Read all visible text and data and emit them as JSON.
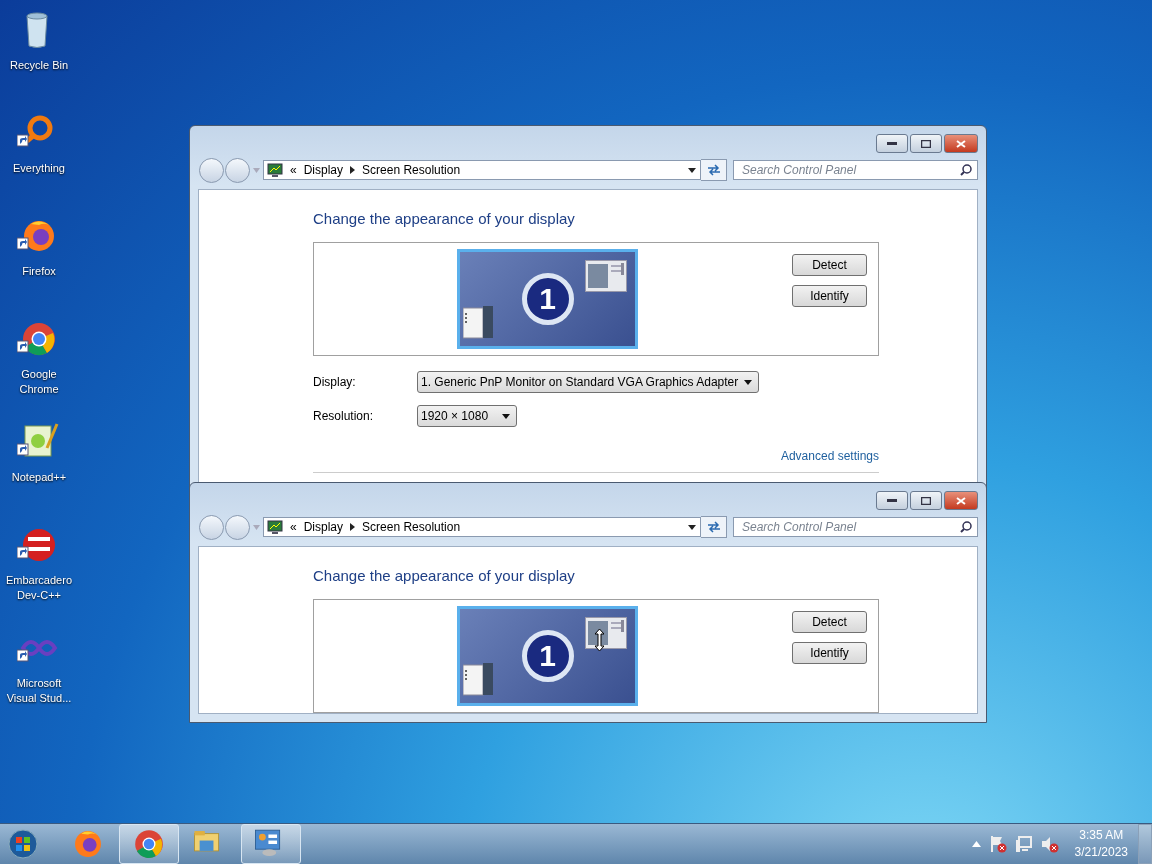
{
  "desktop_icons": [
    {
      "kind": "recycle",
      "label": "Recycle Bin",
      "shortcut": false
    },
    {
      "kind": "everything",
      "label": "Everything",
      "shortcut": true
    },
    {
      "kind": "firefox",
      "label": "Firefox",
      "shortcut": true
    },
    {
      "kind": "chrome",
      "label": "Google Chrome",
      "shortcut": true
    },
    {
      "kind": "notepad",
      "label": "Notepad++",
      "shortcut": true
    },
    {
      "kind": "devcpp",
      "label": "Embarcadero Dev-C++",
      "shortcut": true
    },
    {
      "kind": "vs",
      "label": "Microsoft Visual Stud...",
      "shortcut": true
    }
  ],
  "windows": [
    {
      "overflow": "«",
      "breadcrumb": [
        "Display",
        "Screen Resolution"
      ],
      "search": {
        "placeholder": "Search Control Panel"
      },
      "heading": "Change the appearance of your display",
      "monitor_number": "1",
      "resize_cursor": false,
      "buttons": [
        "Detect",
        "Identify"
      ],
      "settings": [
        {
          "label": "Display:",
          "value": "1. Generic PnP Monitor on Standard VGA Graphics Adapter",
          "kind": "wide"
        },
        {
          "label": "Resolution:",
          "value": "1920 × 1080",
          "kind": "narrow"
        }
      ],
      "link": "Advanced settings"
    },
    {
      "overflow": "«",
      "breadcrumb": [
        "Display",
        "Screen Resolution"
      ],
      "search": {
        "placeholder": "Search Control Panel"
      },
      "heading": "Change the appearance of your display",
      "monitor_number": "1",
      "resize_cursor": true,
      "buttons": [
        "Detect",
        "Identify"
      ]
    }
  ],
  "taskbar": {
    "items": [
      {
        "kind": "firefox",
        "open": false
      },
      {
        "kind": "chrome",
        "open": true
      },
      {
        "kind": "explorer",
        "open": false
      },
      {
        "kind": "control",
        "open": true
      }
    ],
    "clock": {
      "time": "3:35 AM",
      "date": "3/21/2023"
    }
  }
}
